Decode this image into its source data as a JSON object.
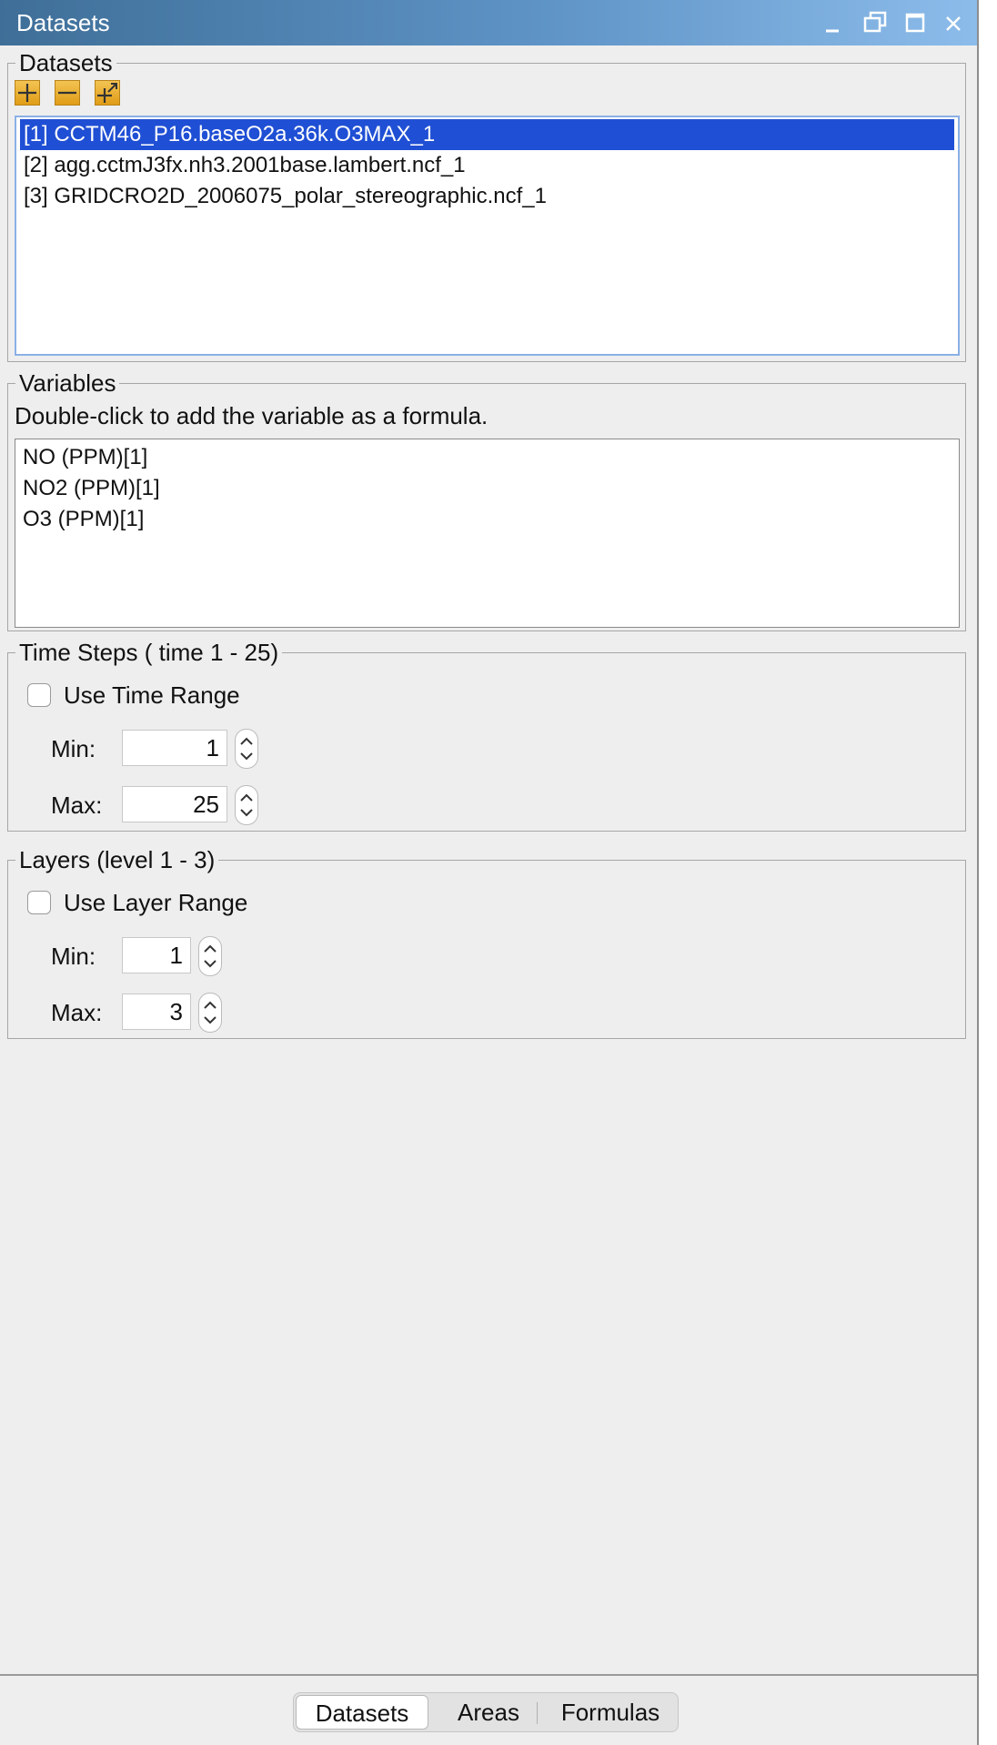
{
  "window": {
    "title": "Datasets"
  },
  "datasets_panel": {
    "legend": "Datasets",
    "items": [
      "[1] CCTM46_P16.baseO2a.36k.O3MAX_1",
      "[2] agg.cctmJ3fx.nh3.2001base.lambert.ncf_1",
      "[3] GRIDCRO2D_2006075_polar_stereographic.ncf_1"
    ],
    "selected_index": 0
  },
  "variables_panel": {
    "legend": "Variables",
    "hint": "Double-click to add the variable as a formula.",
    "items": [
      "NO (PPM)[1]",
      "NO2 (PPM)[1]",
      "O3 (PPM)[1]"
    ]
  },
  "time_steps": {
    "legend": "Time Steps ( time 1 - 25)",
    "checkbox_label": "Use Time Range",
    "checked": false,
    "min_label": "Min:",
    "min_value": "1",
    "max_label": "Max:",
    "max_value": "25"
  },
  "layers": {
    "legend": "Layers (level 1 - 3)",
    "checkbox_label": "Use Layer Range",
    "checked": false,
    "min_label": "Min:",
    "min_value": "1",
    "max_label": "Max:",
    "max_value": "3"
  },
  "tabs": [
    {
      "label": "Datasets",
      "active": true
    },
    {
      "label": "Areas",
      "active": false
    },
    {
      "label": "Formulas",
      "active": false
    }
  ],
  "colors": {
    "selection": "#1f4fd4",
    "title_gradient_start": "#3f6f98",
    "title_gradient_end": "#8cbcea",
    "icon_button": "#e9ab2a"
  }
}
